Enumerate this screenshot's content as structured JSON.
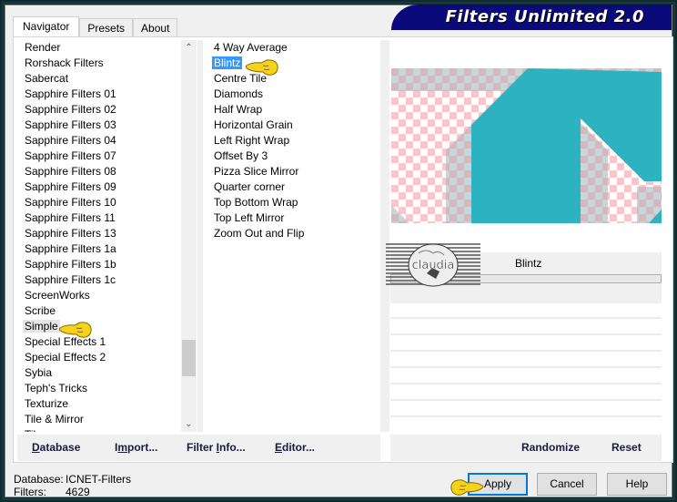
{
  "window": {
    "title": "Filters Unlimited 2.0"
  },
  "tabs": [
    {
      "label": "Navigator",
      "active": true
    },
    {
      "label": "Presets",
      "active": false
    },
    {
      "label": "About",
      "active": false
    }
  ],
  "categories": {
    "items": [
      "Render",
      "Rorshack Filters",
      "Sabercat",
      "Sapphire Filters 01",
      "Sapphire Filters 02",
      "Sapphire Filters 03",
      "Sapphire Filters 04",
      "Sapphire Filters 07",
      "Sapphire Filters 08",
      "Sapphire Filters 09",
      "Sapphire Filters 10",
      "Sapphire Filters 11",
      "Sapphire Filters 13",
      "Sapphire Filters 1a",
      "Sapphire Filters 1b",
      "Sapphire Filters 1c",
      "ScreenWorks",
      "Scribe",
      "Simple",
      "Special Effects 1",
      "Special Effects 2",
      "Sybia",
      "Teph's Tricks",
      "Texturize",
      "Tile & Mirror",
      "Tile..."
    ],
    "selected": "Simple",
    "scroll_position_fraction": 0.85
  },
  "filters": {
    "items": [
      "4 Way Average",
      "Blintz",
      "Centre Tile",
      "Diamonds",
      "Half Wrap",
      "Horizontal Grain",
      "Left Right Wrap",
      "Offset By 3",
      "Pizza Slice Mirror",
      "Quarter corner",
      "Top Bottom Wrap",
      "Top Left Mirror",
      "Zoom Out and Flip"
    ],
    "selected": "Blintz"
  },
  "preview": {
    "shape_color": "#2db3c0",
    "checker_pink": "#ffc4c8",
    "checker_gray": "#c8d8dc"
  },
  "controls": {
    "filter_name": "Blintz",
    "logo_text": "claudia"
  },
  "left_buttons": {
    "database": {
      "label": "Database",
      "accel": "D"
    },
    "import": {
      "label": "Import...",
      "accel": "m"
    },
    "filter_info": {
      "label": "Filter Info...",
      "accel": "I"
    },
    "editor": {
      "label": "Editor...",
      "accel": "E"
    }
  },
  "right_buttons": {
    "randomize": "Randomize",
    "reset": "Reset"
  },
  "status": {
    "database_label": "Database:",
    "database_value": "ICNET-Filters",
    "filters_label": "Filters:",
    "filters_value": "4629"
  },
  "dialog_buttons": {
    "apply": "Apply",
    "cancel": "Cancel",
    "help": "Help"
  },
  "accent_color": "#0078d7",
  "selection_color": "#3399ff"
}
